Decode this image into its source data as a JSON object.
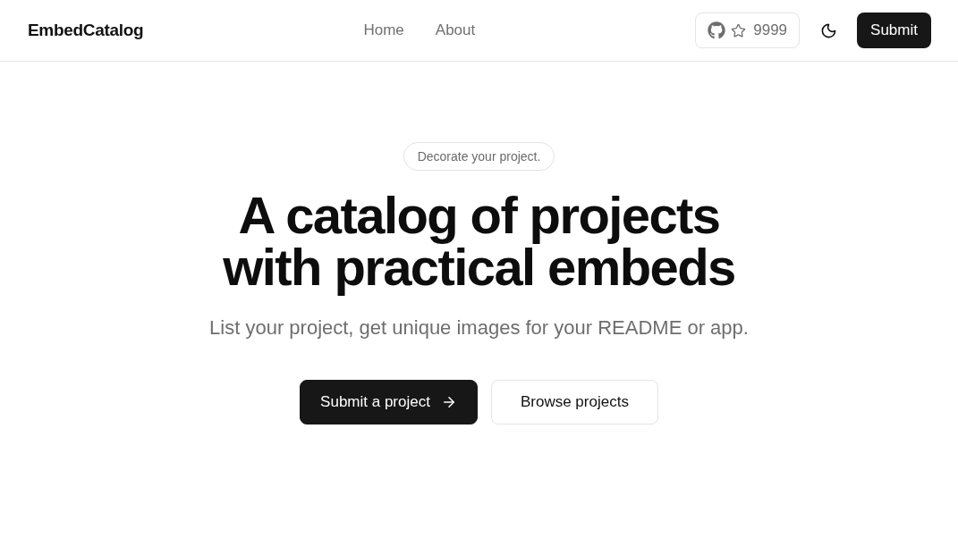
{
  "header": {
    "logo": "EmbedCatalog",
    "nav": [
      {
        "label": "Home"
      },
      {
        "label": "About"
      }
    ],
    "github": {
      "stars": "9999"
    },
    "submit": "Submit"
  },
  "hero": {
    "badge": "Decorate your project.",
    "title": "A catalog of projects with practical embeds",
    "subtitle": "List your project, get unique images for your README or app.",
    "actions": [
      {
        "label": "Submit a project",
        "kind": "primary"
      },
      {
        "label": "Browse projects",
        "kind": "secondary"
      }
    ]
  }
}
